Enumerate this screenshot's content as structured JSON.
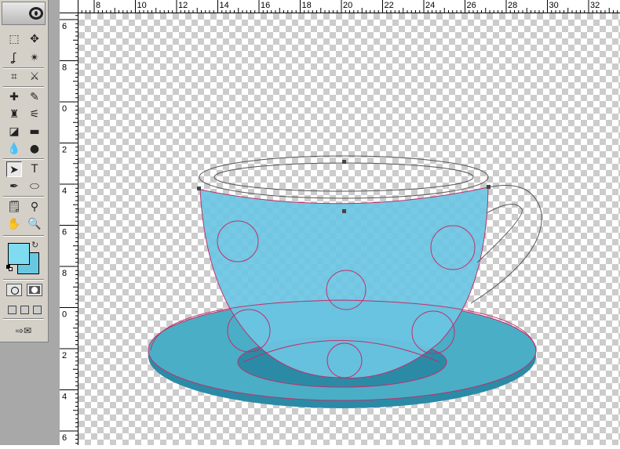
{
  "app": {
    "name": "Photoshop"
  },
  "toolbox": {
    "tools": [
      "marquee-tool",
      "move-tool",
      "lasso-tool",
      "magic-wand-tool",
      "crop-tool",
      "slice-tool",
      "healing-brush-tool",
      "brush-tool",
      "clone-stamp-tool",
      "history-brush-tool",
      "eraser-tool",
      "gradient-tool",
      "blur-tool",
      "dodge-tool",
      "path-selection-tool",
      "type-tool",
      "pen-tool",
      "ellipse-tool",
      "notes-tool",
      "eyedropper-tool",
      "hand-tool",
      "zoom-tool"
    ],
    "active_tool": "path-selection-tool",
    "type_tool_label": "T",
    "foreground_color": "#7fdcf0",
    "background_color": "#68c8e2"
  },
  "ruler": {
    "top_labels": [
      "8",
      "10",
      "12",
      "14",
      "16",
      "18",
      "20",
      "22",
      "24",
      "26",
      "28",
      "30",
      "32"
    ],
    "left_labels": [
      "6",
      "8",
      "0",
      "2",
      "4",
      "6",
      "8",
      "0",
      "2",
      "4",
      "6"
    ]
  },
  "artwork": {
    "cup_color": "#6ac6e3",
    "saucer_color": "#4aaec6",
    "saucer_shadow_color": "#2b8ba6",
    "path_color": "#c0306a"
  }
}
